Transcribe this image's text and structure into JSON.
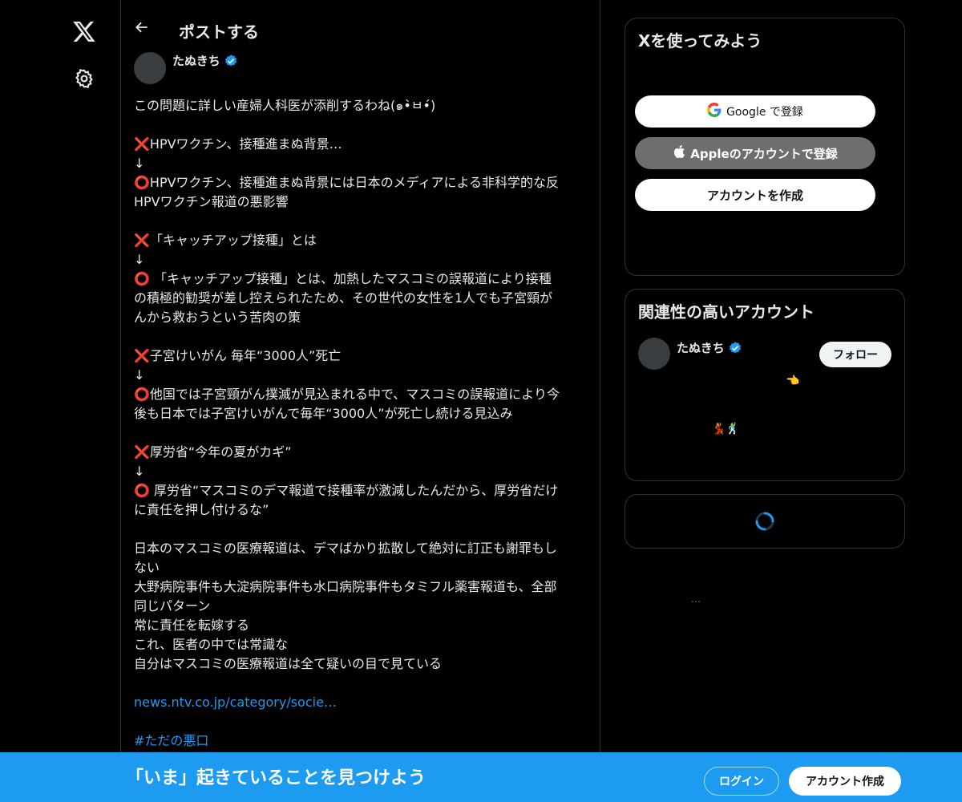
{
  "nav": {
    "logo_icon": "x-logo-icon",
    "settings_icon": "gear-icon"
  },
  "header": {
    "back_icon": "arrow-left-icon",
    "title": "ポストする"
  },
  "post": {
    "author": "たぬきち",
    "lines": [
      "この問題に詳しい産婦人科医が添削するわね(๑•̀ㅂ•́)",
      "",
      "❌HPVワクチン、接種進まぬ背景…",
      "↓",
      "⭕HPVワクチン、接種進まぬ背景には日本のメディアによる非科学的な反",
      "HPVワクチン報道の悪影響",
      "",
      "❌「キャッチアップ接種」とは",
      "↓",
      "⭕ 「キャッチアップ接種」とは、加熱したマスコミの誤報道により接種",
      "の積極的勧奨が差し控えられたため、その世代の女性を1人でも子宮頸が",
      "んから救おうという苦肉の策",
      "",
      "❌子宮けいがん 毎年“3000人”死亡",
      "↓",
      "⭕他国では子宮頸がん撲滅が見込まれる中で、マスコミの誤報道により今",
      "後も日本では子宮けいがんで毎年“3000人”が死亡し続ける見込み",
      "",
      "❌厚労省“今年の夏がカギ”",
      "↓",
      "⭕ 厚労省“マスコミのデマ報道で接種率が激減したんだから、厚労省だけ",
      "に責任を押し付けるな”",
      "",
      "日本のマスコミの医療報道は、デマばかり拡散して絶対に訂正も謝罪もし",
      "ない",
      "大野病院事件も大淀病院事件も水口病院事件もタミフル薬害報道も、全部",
      "同じパターン",
      "常に責任を転嫁する",
      "これ、医者の中では常識な",
      "自分はマスコミの医療報道は全て疑いの目で見ている",
      ""
    ],
    "link": "news.ntv.co.jp/category/socie…",
    "hashtag": "#ただの悪口"
  },
  "signup_card": {
    "title": "Xを使ってみよう",
    "google_label": "Google で登録",
    "apple_label": "Appleのアカウントで登録",
    "create_label": "アカウントを作成"
  },
  "related": {
    "title": "関連性の高いアカウント",
    "name": "たぬきち",
    "follow_label": "フォロー",
    "emoji_a": "👈",
    "emoji_b": "💃🕺"
  },
  "misc": {
    "dots": "…"
  },
  "bottom_bar": {
    "text": "「いま」起きていることを見つけよう",
    "login_label": "ログイン",
    "signup_label": "アカウント作成"
  },
  "colors": {
    "accent": "#1d9bf0",
    "background": "#000000",
    "border": "#2f3336"
  }
}
